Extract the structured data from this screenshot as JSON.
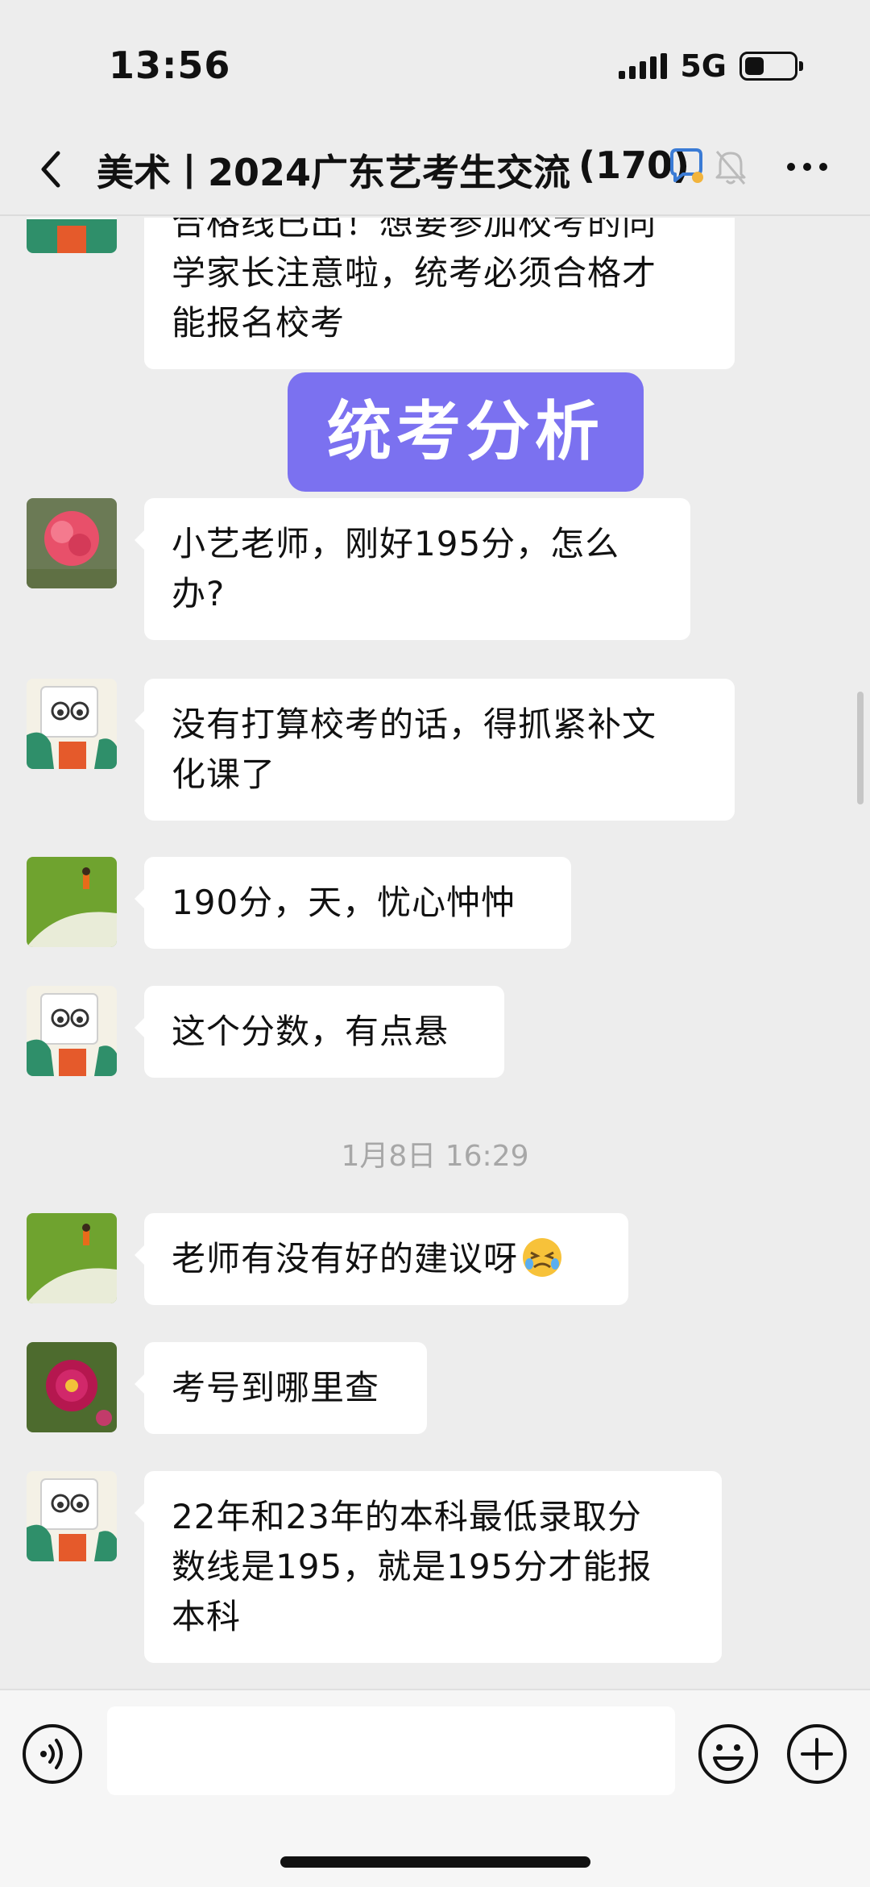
{
  "status_bar": {
    "time": "13:56",
    "network": "5G",
    "battery_level": 0.4
  },
  "header": {
    "title": "美术丨2024广东艺考生交流",
    "member_count": "(170)",
    "icons": [
      "back-icon",
      "chat-bubble-icon",
      "mute-bell-icon",
      "more-icon"
    ]
  },
  "banner": {
    "text": "统考分析"
  },
  "messages": [
    {
      "sender": "teacher",
      "text_lines": [
        "合格线已出！想要参加校考的同",
        "学家长注意啦，统考必须合格才",
        "能报名校考"
      ]
    },
    {
      "sender": "student_pink_flower",
      "text_lines": [
        "小艺老师，刚好195分，怎么",
        "办?"
      ]
    },
    {
      "sender": "teacher",
      "text_lines": [
        "没有打算校考的话，得抓紧补文",
        "化课了"
      ]
    },
    {
      "sender": "student_green_field",
      "text_lines": [
        "190分，天，忧心忡忡"
      ]
    },
    {
      "sender": "teacher",
      "text_lines": [
        "这个分数，有点悬"
      ]
    },
    {
      "sender": "student_green_field",
      "text_lines": [
        "老师有没有好的建议呀"
      ],
      "emoji": "crying-face-emoji"
    },
    {
      "sender": "student_cosmos_flower",
      "text_lines": [
        "考号到哪里查"
      ]
    },
    {
      "sender": "teacher",
      "text_lines": [
        "22年和23年的本科最低录取分",
        "数线是195，就是195分才能报",
        "本科"
      ]
    }
  ],
  "timestamp": "1月8日 16:29",
  "input": {
    "value": "",
    "placeholder": ""
  },
  "colors": {
    "background": "#ededed",
    "bubble": "#ffffff",
    "banner": "#7b71f0",
    "timestamp": "#a7a7a7"
  }
}
